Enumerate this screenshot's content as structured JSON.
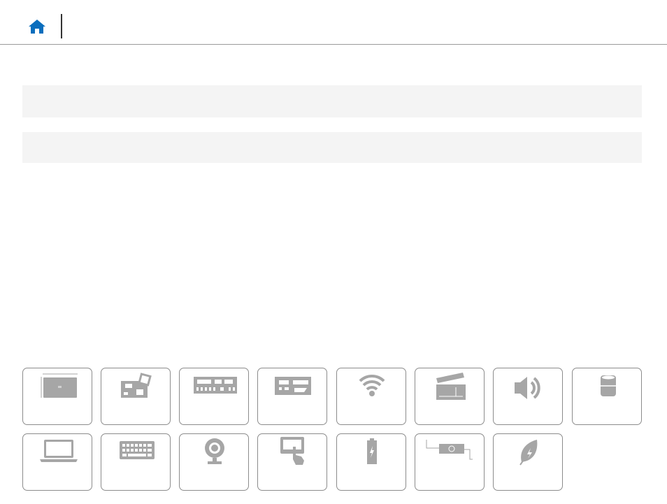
{
  "colors": {
    "accent": "#0a6ebd",
    "icon_gray": "#a6a6a6",
    "tile_border": "#8c8c8c",
    "panel_bg": "#f4f4f4"
  },
  "header": {
    "home_icon": "home-icon"
  },
  "tiles_row1": [
    {
      "icon": "dimensions-icon"
    },
    {
      "icon": "system-board-icon"
    },
    {
      "icon": "ports-icon"
    },
    {
      "icon": "card-reader-icon"
    },
    {
      "icon": "wifi-icon"
    },
    {
      "icon": "video-clapperboard-icon"
    },
    {
      "icon": "audio-speaker-icon"
    },
    {
      "icon": "storage-icon"
    }
  ],
  "tiles_row2": [
    {
      "icon": "laptop-display-icon"
    },
    {
      "icon": "keyboard-icon"
    },
    {
      "icon": "webcam-icon"
    },
    {
      "icon": "touchpad-icon"
    },
    {
      "icon": "battery-icon"
    },
    {
      "icon": "power-adapter-icon"
    },
    {
      "icon": "environmental-leaf-icon"
    }
  ]
}
